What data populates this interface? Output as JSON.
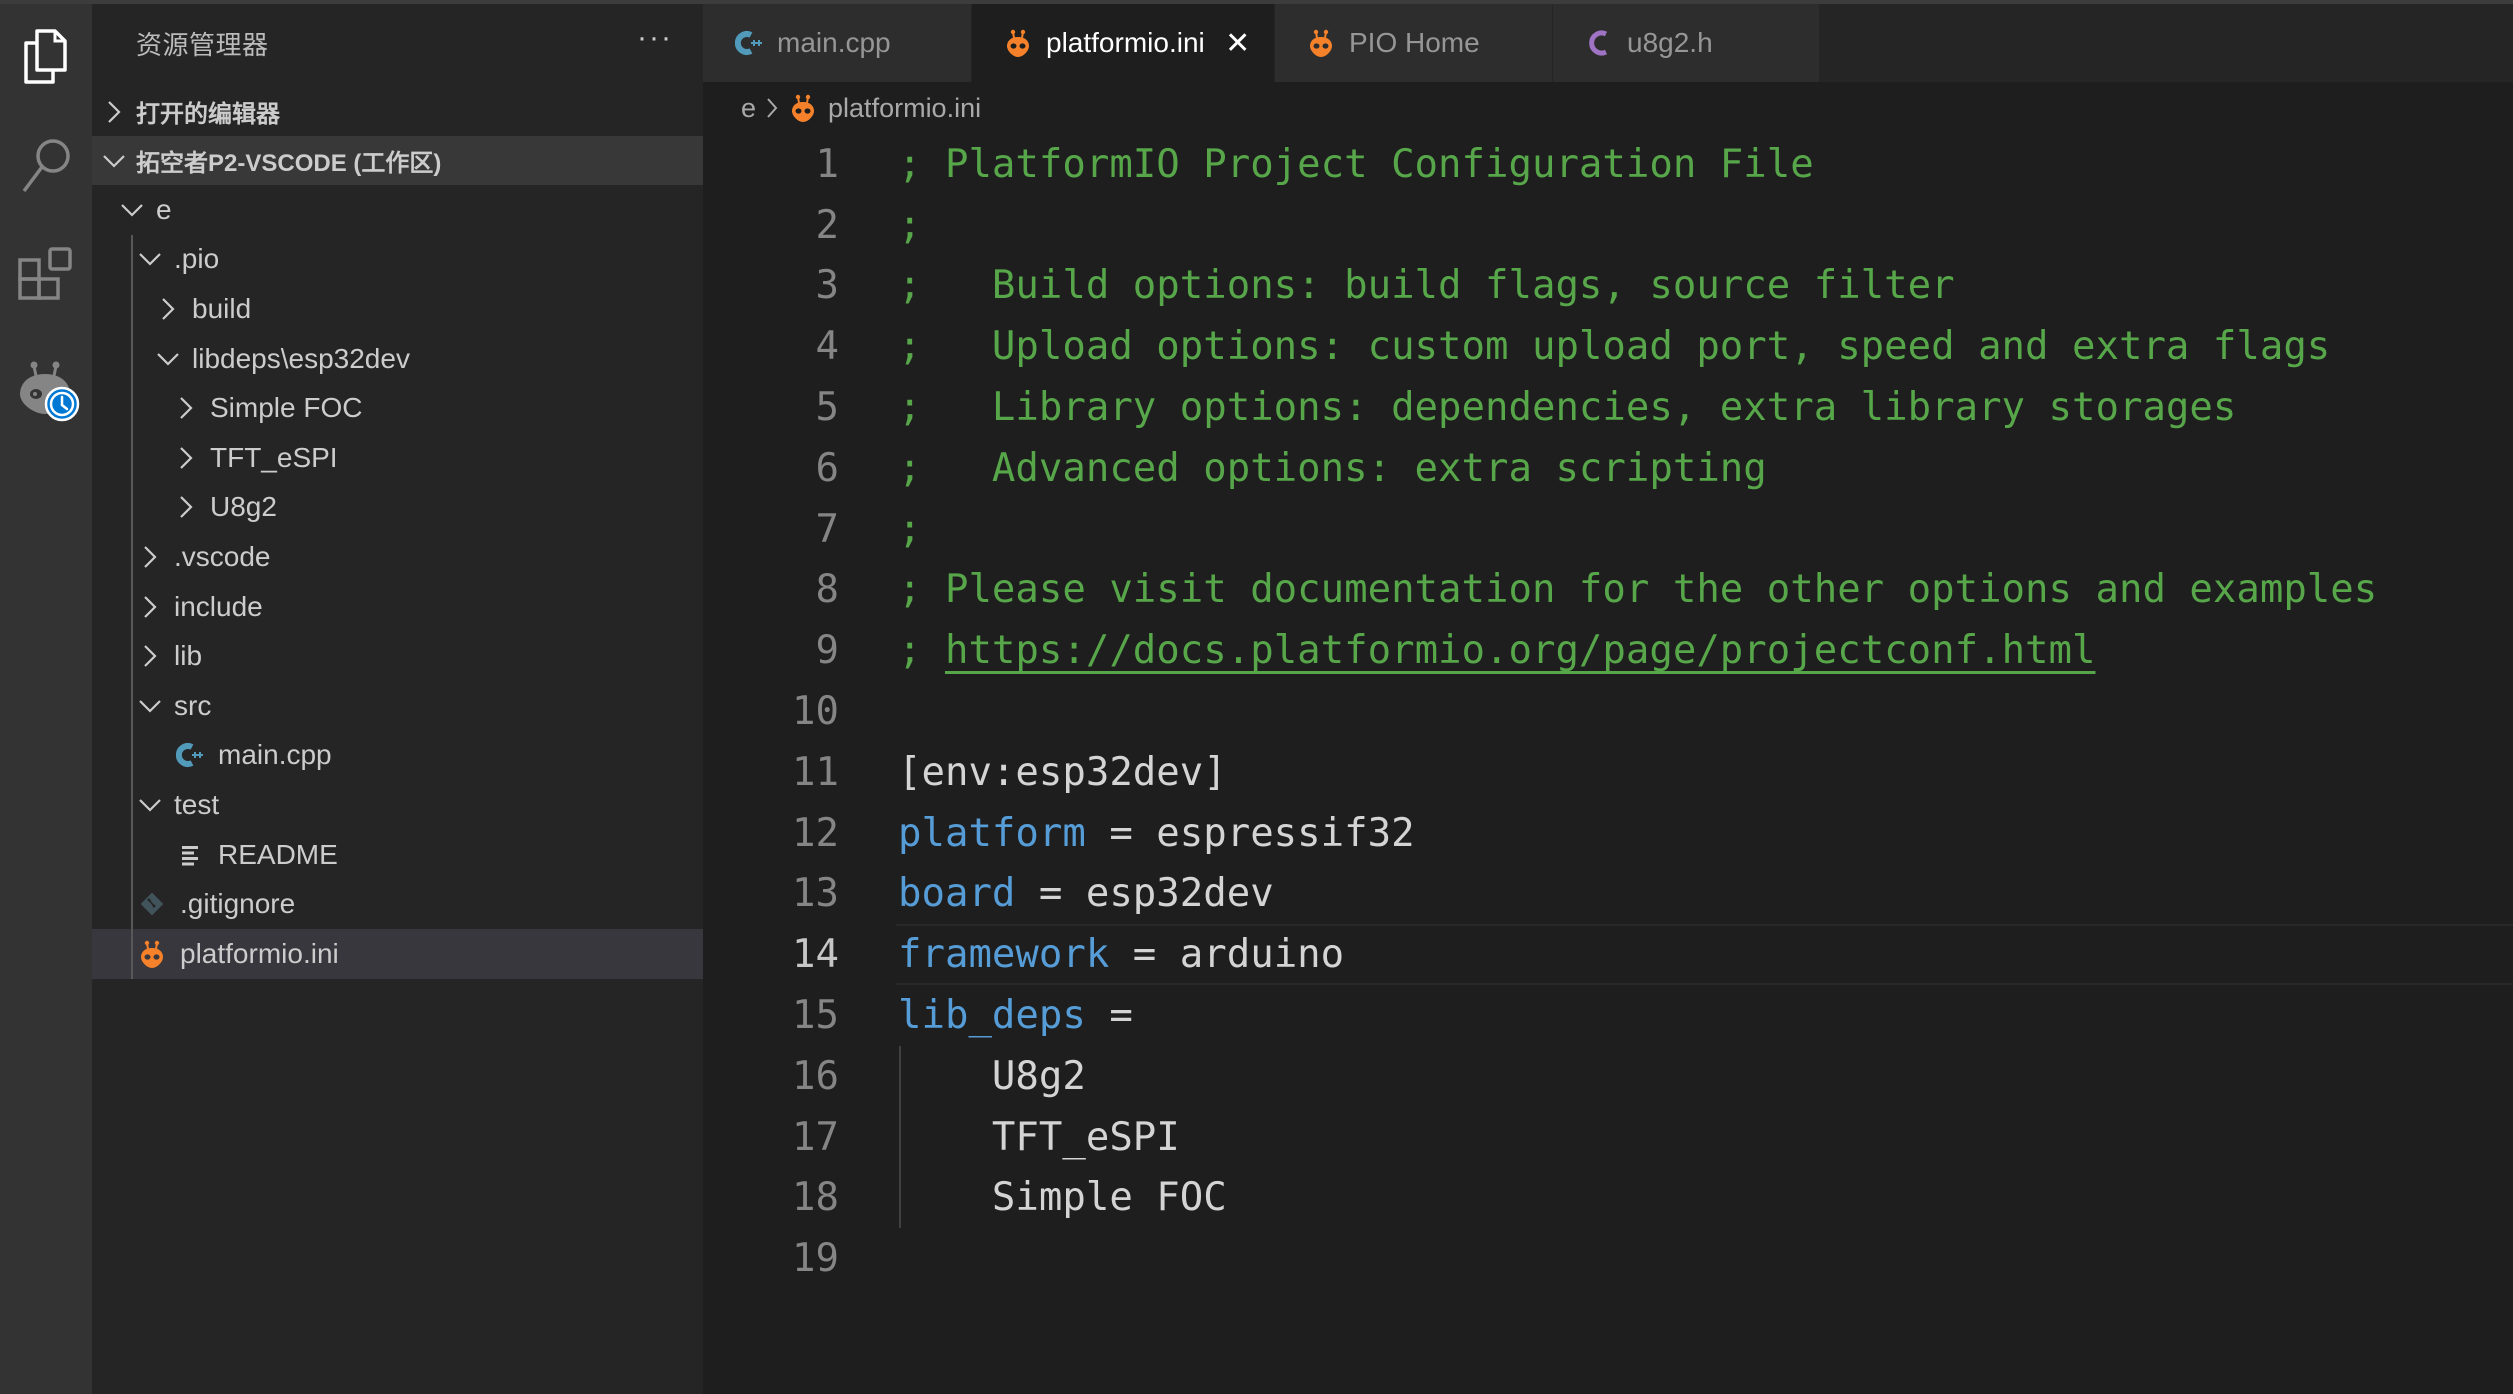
{
  "activity_bar": {
    "items": [
      {
        "name": "explorer",
        "icon": "files-icon",
        "active": true
      },
      {
        "name": "search",
        "icon": "search-icon",
        "active": false
      },
      {
        "name": "extensions",
        "icon": "extensions-icon",
        "active": false
      },
      {
        "name": "platformio",
        "icon": "platformio-alien-icon",
        "badge": "clock-icon",
        "active": false
      }
    ]
  },
  "sidebar": {
    "title": "资源管理器",
    "more_label": "···",
    "sections": {
      "open_editors": "打开的编辑器",
      "workspace": "拓空者P2-VSCODE (工作区)"
    },
    "tree": [
      {
        "label": "e",
        "depth": 0,
        "type": "folder",
        "expanded": true
      },
      {
        "label": ".pio",
        "depth": 1,
        "type": "folder",
        "expanded": true
      },
      {
        "label": "build",
        "depth": 2,
        "type": "folder",
        "expanded": false
      },
      {
        "label": "libdeps\\esp32dev",
        "depth": 2,
        "type": "folder",
        "expanded": true
      },
      {
        "label": "Simple FOC",
        "depth": 3,
        "type": "folder",
        "expanded": false
      },
      {
        "label": "TFT_eSPI",
        "depth": 3,
        "type": "folder",
        "expanded": false
      },
      {
        "label": "U8g2",
        "depth": 3,
        "type": "folder",
        "expanded": false
      },
      {
        "label": ".vscode",
        "depth": 1,
        "type": "folder",
        "expanded": false
      },
      {
        "label": "include",
        "depth": 1,
        "type": "folder",
        "expanded": false
      },
      {
        "label": "lib",
        "depth": 1,
        "type": "folder",
        "expanded": false
      },
      {
        "label": "src",
        "depth": 1,
        "type": "folder",
        "expanded": true
      },
      {
        "label": "main.cpp",
        "depth": 2,
        "type": "cpp"
      },
      {
        "label": "test",
        "depth": 1,
        "type": "folder",
        "expanded": true
      },
      {
        "label": "README",
        "depth": 2,
        "type": "text"
      },
      {
        "label": ".gitignore",
        "depth": 1,
        "type": "git"
      },
      {
        "label": "platformio.ini",
        "depth": 1,
        "type": "pio",
        "selected": true
      }
    ]
  },
  "tabs": [
    {
      "label": "main.cpp",
      "icon": "cpp-icon",
      "active": false
    },
    {
      "label": "platformio.ini",
      "icon": "platformio-icon",
      "active": true,
      "close_label": "✕"
    },
    {
      "label": "PIO Home",
      "icon": "platformio-icon",
      "active": false
    },
    {
      "label": "u8g2.h",
      "icon": "c-header-icon",
      "active": false
    }
  ],
  "breadcrumb": {
    "items": [
      "e",
      "platformio.ini"
    ]
  },
  "editor": {
    "current_line": 14,
    "lines": [
      {
        "n": "1",
        "tokens": [
          {
            "t": "; PlatformIO Project Configuration File",
            "c": "cmt"
          }
        ]
      },
      {
        "n": "2",
        "tokens": [
          {
            "t": ";",
            "c": "cmt"
          }
        ]
      },
      {
        "n": "3",
        "tokens": [
          {
            "t": ";   Build options: build flags, source filter",
            "c": "cmt"
          }
        ]
      },
      {
        "n": "4",
        "tokens": [
          {
            "t": ";   Upload options: custom upload port, speed and extra flags",
            "c": "cmt"
          }
        ]
      },
      {
        "n": "5",
        "tokens": [
          {
            "t": ";   Library options: dependencies, extra library storages",
            "c": "cmt"
          }
        ]
      },
      {
        "n": "6",
        "tokens": [
          {
            "t": ";   Advanced options: extra scripting",
            "c": "cmt"
          }
        ]
      },
      {
        "n": "7",
        "tokens": [
          {
            "t": ";",
            "c": "cmt"
          }
        ]
      },
      {
        "n": "8",
        "tokens": [
          {
            "t": "; Please visit documentation for the other options and examples",
            "c": "cmt"
          }
        ]
      },
      {
        "n": "9",
        "tokens": [
          {
            "t": "; ",
            "c": "cmt"
          },
          {
            "t": "https://docs.platformio.org/page/projectconf.html",
            "c": "cmt link"
          }
        ]
      },
      {
        "n": "10",
        "tokens": []
      },
      {
        "n": "11",
        "tokens": [
          {
            "t": "[env:esp32dev]",
            "c": "val"
          }
        ]
      },
      {
        "n": "12",
        "tokens": [
          {
            "t": "platform",
            "c": "key"
          },
          {
            "t": " = espressif32",
            "c": "val"
          }
        ]
      },
      {
        "n": "13",
        "tokens": [
          {
            "t": "board",
            "c": "key"
          },
          {
            "t": " = esp32dev",
            "c": "val"
          }
        ]
      },
      {
        "n": "14",
        "tokens": [
          {
            "t": "framework",
            "c": "key"
          },
          {
            "t": " = arduino",
            "c": "val"
          }
        ]
      },
      {
        "n": "15",
        "tokens": [
          {
            "t": "lib_deps",
            "c": "key"
          },
          {
            "t": " =",
            "c": "val"
          }
        ]
      },
      {
        "n": "16",
        "tokens": [
          {
            "t": "    U8g2",
            "c": "val"
          }
        ]
      },
      {
        "n": "17",
        "tokens": [
          {
            "t": "    TFT_eSPI",
            "c": "val"
          }
        ]
      },
      {
        "n": "18",
        "tokens": [
          {
            "t": "    Simple FOC",
            "c": "val"
          }
        ]
      },
      {
        "n": "19",
        "tokens": []
      }
    ]
  },
  "colors": {
    "comment": "#57a64a",
    "key": "#569cd6",
    "value": "#d4d4d4",
    "platformio_orange": "#f5822a",
    "cpp_blue": "#519aba",
    "c_purple": "#a074c4",
    "badge_blue": "#0078d4"
  }
}
